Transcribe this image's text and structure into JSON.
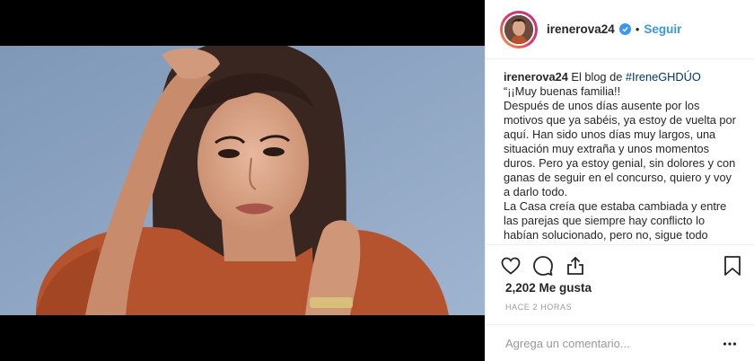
{
  "header": {
    "username": "irenerova24",
    "separator": "•",
    "follow_label": "Seguir"
  },
  "icons": {
    "verified": "verified-badge-icon",
    "like": "heart-icon",
    "comment": "comment-icon",
    "share": "share-icon",
    "save": "bookmark-icon",
    "more": "more-options-icon"
  },
  "caption": {
    "username": "irenerova24",
    "intro": "El blog de",
    "hashtag": "#IreneGHDÚO",
    "lines": [
      "“¡¡Muy buenas familia!!",
      "Después de unos días ausente por los motivos que ya sabéis, ya estoy de vuelta por aquí. Han sido unos días muy largos, una situación muy extraña y unos momentos duros. Pero ya estoy genial, sin dolores y con ganas de seguir en el concurso, quiero y voy a darlo todo.",
      "La Casa creía que estaba cambiada y entre las parejas que siempre hay conflicto lo habían solucionado, pero no, sigue todo"
    ]
  },
  "stats": {
    "likes": "2,202 Me gusta",
    "time": "HACE 2 HORAS"
  },
  "comment_box": {
    "placeholder": "Agrega un comentario..."
  },
  "colors": {
    "accent": "#3897f0",
    "hashtag": "#003569",
    "photo_background": "#8fa6c4",
    "top_garment": "#b5532f"
  }
}
